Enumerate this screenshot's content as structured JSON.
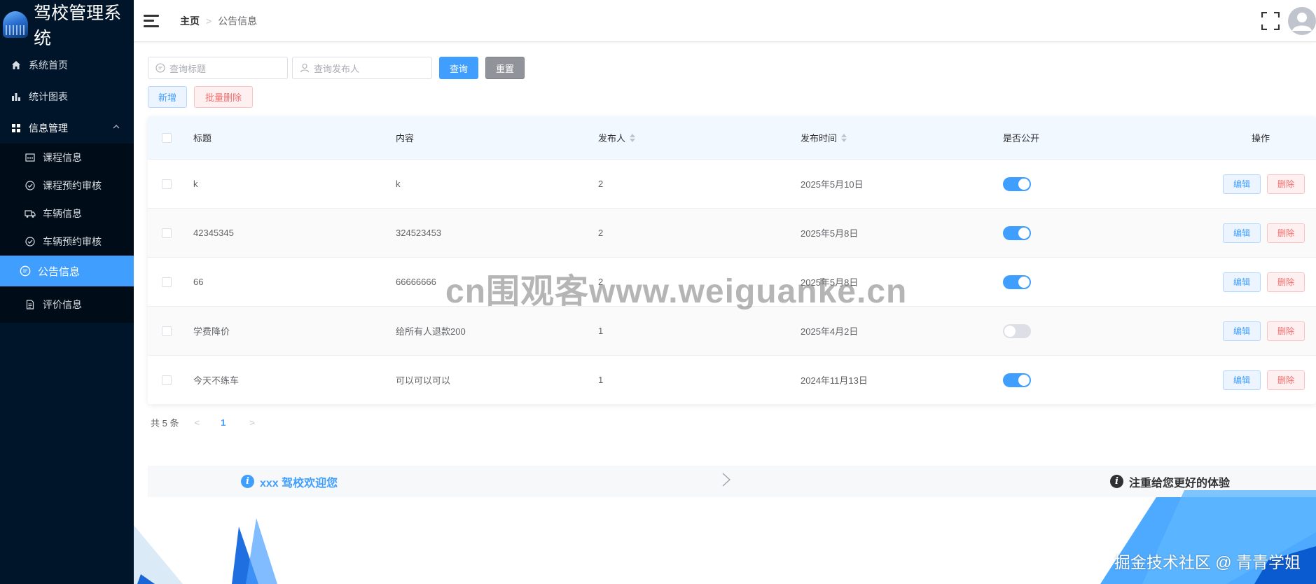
{
  "app": {
    "title": "驾校管理系统"
  },
  "sidebar": {
    "items": [
      {
        "label": "系统首页",
        "icon": "home-icon"
      },
      {
        "label": "统计图表",
        "icon": "bar-chart-icon"
      },
      {
        "label": "信息管理",
        "icon": "grid-icon",
        "expanded": true
      },
      {
        "label": "课程信息",
        "icon": "calendar-icon"
      },
      {
        "label": "课程预约审核",
        "icon": "check-circle-icon"
      },
      {
        "label": "车辆信息",
        "icon": "truck-icon"
      },
      {
        "label": "车辆预约审核",
        "icon": "check-circle-icon"
      },
      {
        "label": "公告信息",
        "icon": "chat-icon",
        "active": true
      },
      {
        "label": "评价信息",
        "icon": "document-icon"
      }
    ]
  },
  "header": {
    "breadcrumb": {
      "home": "主页",
      "current": "公告信息"
    }
  },
  "search": {
    "title_placeholder": "查询标题",
    "publisher_placeholder": "查询发布人",
    "query_label": "查询",
    "reset_label": "重置"
  },
  "actions": {
    "add_label": "新增",
    "batch_delete_label": "批量删除"
  },
  "table": {
    "columns": [
      "标题",
      "内容",
      "发布人",
      "发布时间",
      "是否公开",
      "操作"
    ],
    "rows": [
      {
        "title": "k",
        "content": "k",
        "publisher": "2",
        "date": "2025年5月10日",
        "public": true
      },
      {
        "title": "42345345",
        "content": "324523453",
        "publisher": "2",
        "date": "2025年5月8日",
        "public": true
      },
      {
        "title": "66",
        "content": "66666666",
        "publisher": "2",
        "date": "2025年5月8日",
        "public": true
      },
      {
        "title": "学费降价",
        "content": "给所有人退款200",
        "publisher": "1",
        "date": "2025年4月2日",
        "public": false
      },
      {
        "title": "今天不练车",
        "content": "可以可以可以",
        "publisher": "1",
        "date": "2024年11月13日",
        "public": true
      }
    ],
    "edit_label": "编辑",
    "delete_label": "删除"
  },
  "pagination": {
    "total_text": "共 5 条",
    "current_page": "1"
  },
  "banner": {
    "left_text": "xxx 驾校欢迎您",
    "right_text": "注重给您更好的体验"
  },
  "watermark": "cn围观客www.weiguanke.cn",
  "footer_note": "掘金技术社区 @ 青青学姐",
  "colors": {
    "primary": "#409eff",
    "sidebar": "#001529",
    "danger": "#f56c6c"
  }
}
